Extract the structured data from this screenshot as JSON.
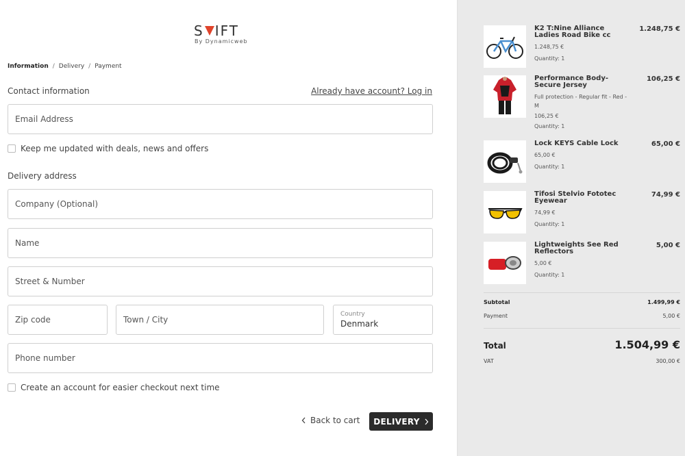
{
  "brand": {
    "logo_left": "S",
    "logo_right": "IFT",
    "logo_sub": "By Dynamicweb"
  },
  "breadcrumb": {
    "step1": "Information",
    "step2": "Delivery",
    "step3": "Payment",
    "separator": "/"
  },
  "contact": {
    "title": "Contact information",
    "login_link": "Already have account? Log in",
    "email_placeholder": "Email Address",
    "newsletter_label": "Keep me updated with deals, news and offers"
  },
  "delivery": {
    "title": "Delivery address",
    "company_placeholder": "Company (Optional)",
    "name_placeholder": "Name",
    "street_placeholder": "Street & Number",
    "zip_placeholder": "Zip code",
    "city_placeholder": "Town / City",
    "country_label": "Country",
    "country_value": "Denmark",
    "phone_placeholder": "Phone number",
    "create_account_label": "Create an account for easier checkout next time"
  },
  "actions": {
    "back_label": "Back to cart",
    "next_label": "DELIVERY"
  },
  "cart": {
    "items": [
      {
        "name": "K2 T:Nine Alliance Ladies Road Bike cc",
        "sub": "",
        "unit_price": "1.248,75 €",
        "quantity": "Quantity: 1",
        "price": "1.248,75 €",
        "icon": "bike-icon"
      },
      {
        "name": "Performance Body-Secure Jersey",
        "sub": "Full protection - Regular fit - Red - M",
        "unit_price": "106,25 €",
        "quantity": "Quantity: 1",
        "price": "106,25 €",
        "icon": "jersey-icon"
      },
      {
        "name": "Lock KEYS Cable Lock",
        "sub": "",
        "unit_price": "65,00 €",
        "quantity": "Quantity: 1",
        "price": "65,00 €",
        "icon": "lock-icon"
      },
      {
        "name": "Tifosi Stelvio Fototec Eyewear",
        "sub": "",
        "unit_price": "74,99 €",
        "quantity": "Quantity: 1",
        "price": "74,99 €",
        "icon": "eyewear-icon"
      },
      {
        "name": "Lightweights See Red Reflectors",
        "sub": "",
        "unit_price": "5,00 €",
        "quantity": "Quantity: 1",
        "price": "5,00 €",
        "icon": "reflector-icon"
      }
    ],
    "subtotal_label": "Subtotal",
    "subtotal_value": "1.499,99 €",
    "payment_label": "Payment",
    "payment_value": "5,00 €",
    "total_label": "Total",
    "total_value": "1.504,99 €",
    "vat_label": "VAT",
    "vat_value": "300,00 €"
  },
  "colors": {
    "brand_accent": "#e0442b",
    "button_dark": "#2b2b2b",
    "summary_bg": "#eaeaea"
  }
}
